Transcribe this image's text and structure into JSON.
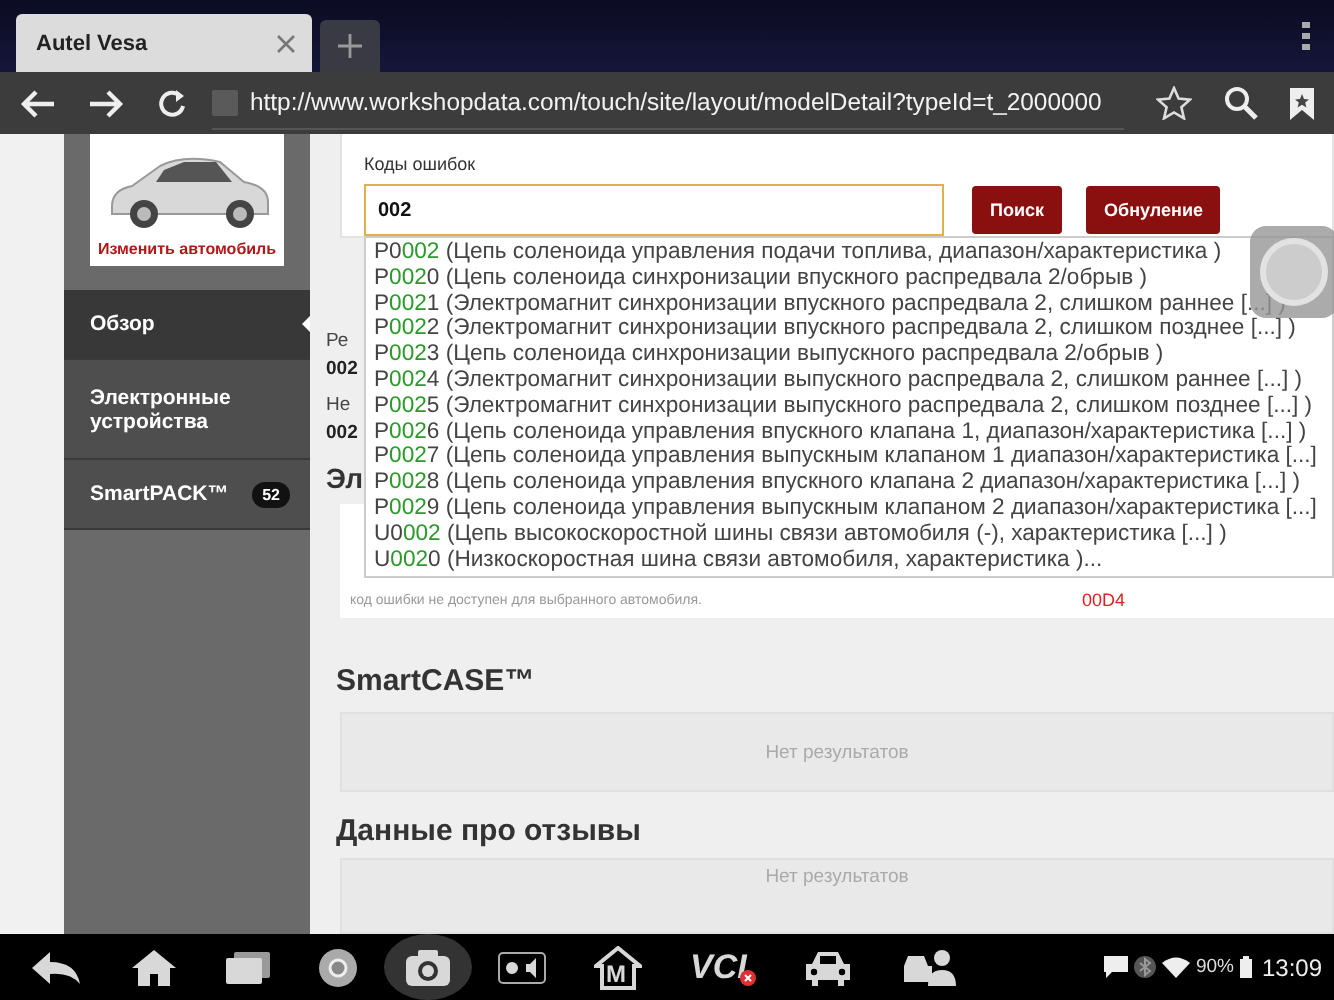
{
  "browser": {
    "tabs": [
      {
        "title": "Autel Vesa",
        "selected": true
      }
    ],
    "url": "http://www.workshopdata.com/touch/site/layout/modelDetail?typeId=t_2000000"
  },
  "sidebar": {
    "change_vehicle": "Изменить автомобиль",
    "items": [
      {
        "label": "Обзор",
        "selected": true
      },
      {
        "label": "Электронные устройства",
        "selected": false
      },
      {
        "label": "SmartPACK™",
        "selected": false,
        "badge": "52"
      }
    ]
  },
  "search": {
    "label": "Коды ошибок",
    "value": "002",
    "buttons": [
      "Поиск",
      "Обнуление"
    ]
  },
  "suggestions": [
    {
      "code_before": "P0",
      "code_match": "002",
      "description": "(Цепь соленоида управления подачи топлива, диапазон/характеристика )"
    },
    {
      "code_before": "P",
      "code_match": "002",
      "code_after": "0",
      "description": "(Цепь соленоида синхронизации впускного распредвала 2/обрыв )"
    },
    {
      "code_before": "P",
      "code_match": "002",
      "code_after": "1",
      "description": "(Электромагнит синхронизации впускного распредвала 2, слишком раннее [...] )"
    },
    {
      "code_before": "P",
      "code_match": "002",
      "code_after": "2",
      "description": "(Электромагнит синхронизации впускного распредвала 2, слишком позднее [...] )"
    },
    {
      "code_before": "P",
      "code_match": "002",
      "code_after": "3",
      "description": "(Цепь соленоида синхронизации выпускного распредвала 2/обрыв )"
    },
    {
      "code_before": "P",
      "code_match": "002",
      "code_after": "4",
      "description": "(Электромагнит синхронизации выпускного распредвала 2, слишком раннее [...] )"
    },
    {
      "code_before": "P",
      "code_match": "002",
      "code_after": "5",
      "description": "(Электромагнит синхронизации выпускного распредвала 2, слишком позднее [...] )"
    },
    {
      "code_before": "P",
      "code_match": "002",
      "code_after": "6",
      "description": "(Цепь соленоида управления впускного клапана 1, диапазон/характеристика [...] )"
    },
    {
      "code_before": "P",
      "code_match": "002",
      "code_after": "7",
      "description": "(Цепь соленоида управления выпускным клапаном 1 диапазон/характеристика [...]"
    },
    {
      "code_before": "P",
      "code_match": "002",
      "code_after": "8",
      "description": "(Цепь соленоида управления впускного клапана 2 диапазон/характеристика [...] )"
    },
    {
      "code_before": "P",
      "code_match": "002",
      "code_after": "9",
      "description": "(Цепь соленоида управления выпускным клапаном 2 диапазон/характеристика [...]"
    },
    {
      "code_before": "U0",
      "code_match": "002",
      "description": "(Цепь высокоскоростной шины связи автомобиля (-), характеристика [...] )"
    },
    {
      "code_before": "U",
      "code_match": "002",
      "code_after": "0",
      "description": "(Низкоскоростная шина связи автомобиля, характеристика )..."
    }
  ],
  "results_partial": [
    "Ре",
    "002",
    "Не",
    "002"
  ],
  "heading_partial": "Эл",
  "error_note": "код ошибки не доступен для выбранного автомобиля.",
  "error_code": "00D4",
  "sections": [
    {
      "title": "SmartCASE™",
      "empty_text": "Нет результатов"
    },
    {
      "title": "Данные про отзывы",
      "empty_text": "Нет результатов"
    }
  ],
  "navbar": {
    "m_label": "M",
    "vci_label": "VCI",
    "battery": "90%",
    "time": "13:09"
  }
}
